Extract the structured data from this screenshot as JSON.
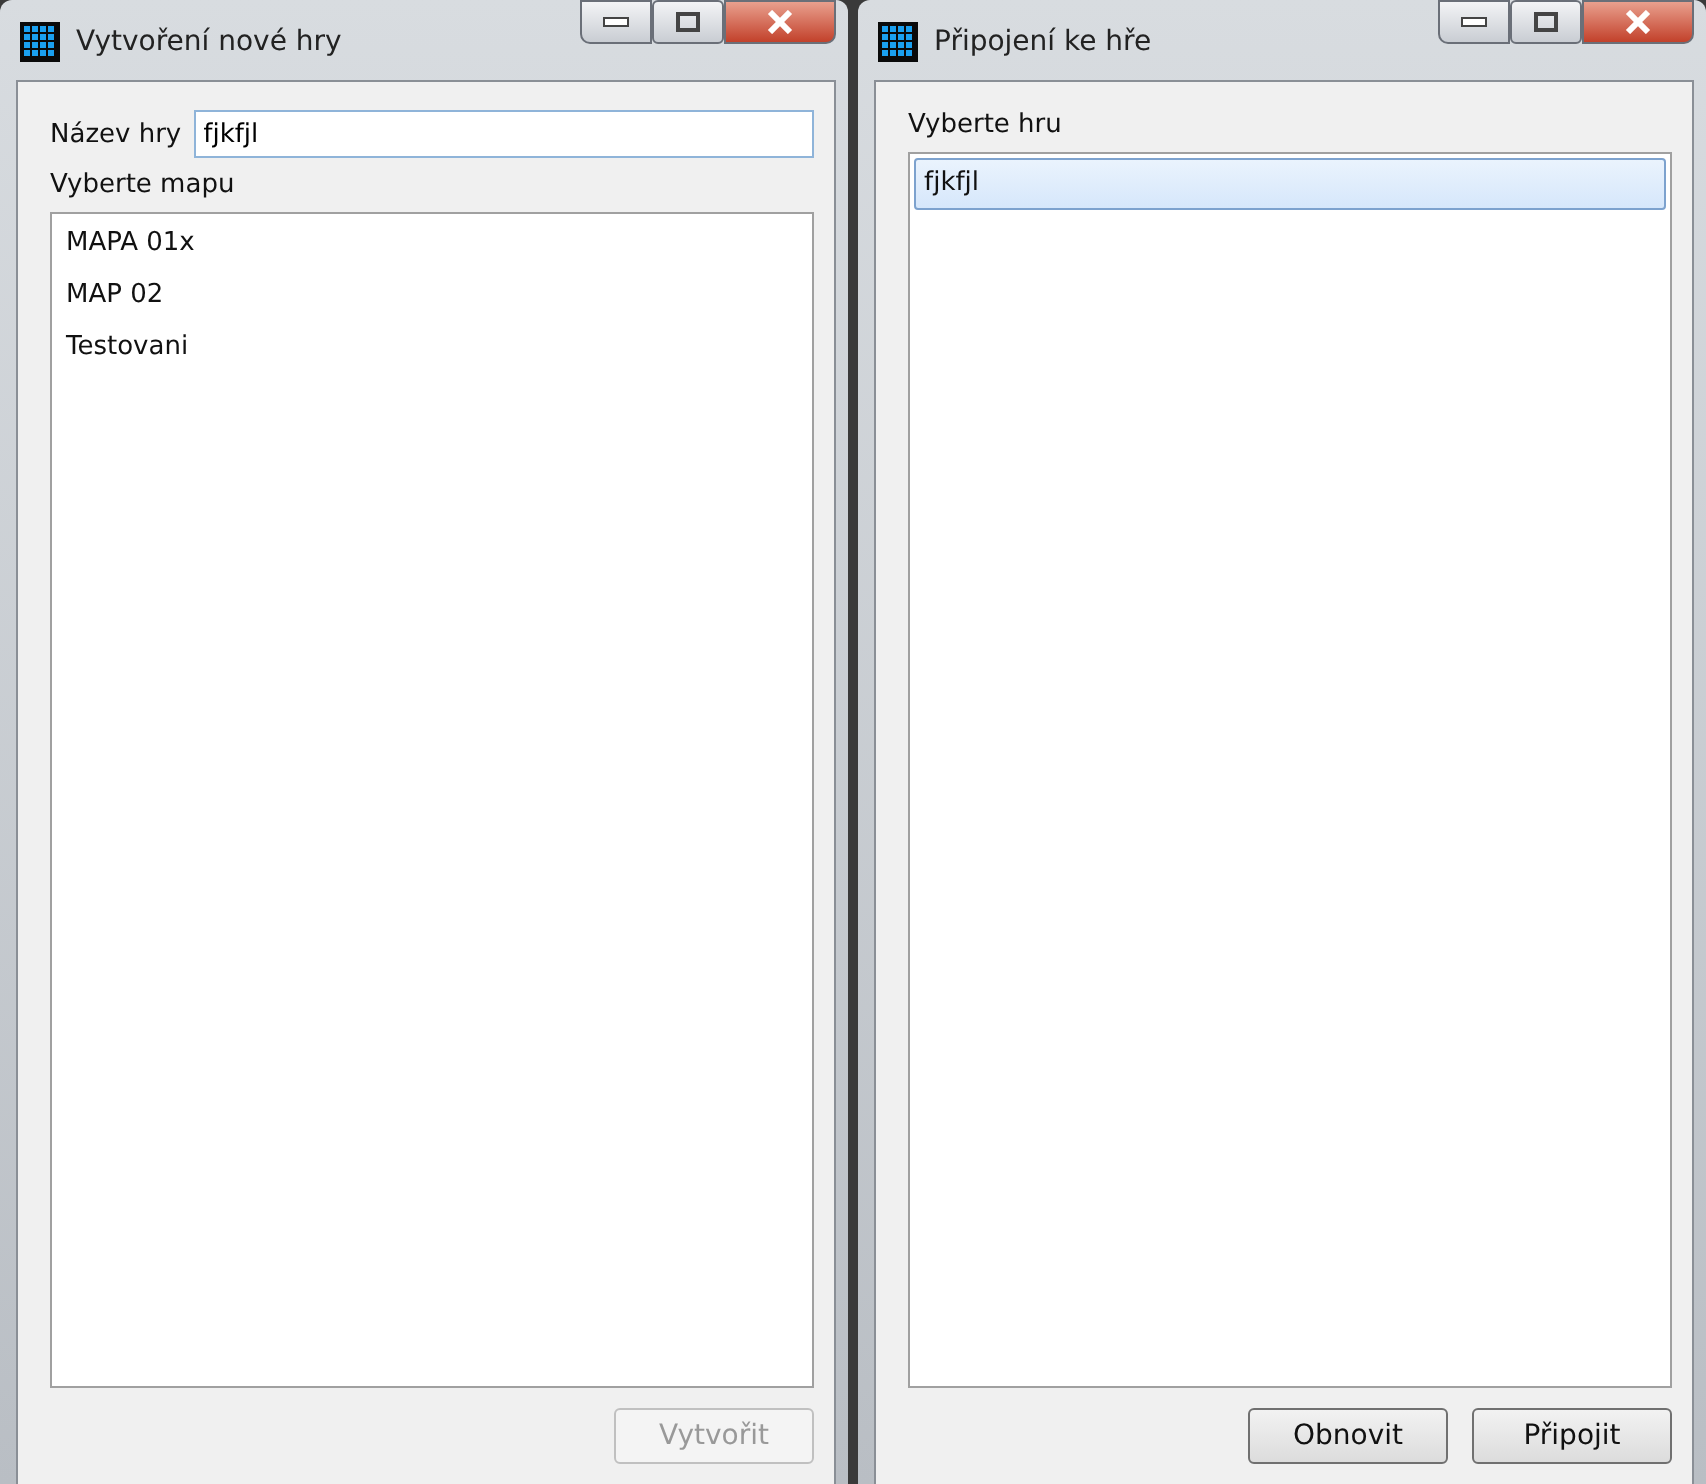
{
  "windows": [
    {
      "title": "Vytvoření nové hry",
      "name_field": {
        "label": "Název hry",
        "value": "fjkfjl"
      },
      "list_label": "Vyberte mapu",
      "items": [
        {
          "label": "MAPA 01x",
          "selected": false
        },
        {
          "label": "MAP 02",
          "selected": false
        },
        {
          "label": "Testovani",
          "selected": false
        }
      ],
      "buttons": [
        {
          "label": "Vytvořit",
          "disabled": true
        }
      ]
    },
    {
      "title": "Připojení ke hře",
      "list_label": "Vyberte hru",
      "items": [
        {
          "label": "fjkfjl",
          "selected": true
        }
      ],
      "buttons": [
        {
          "label": "Obnovit",
          "disabled": false
        },
        {
          "label": "Připojit",
          "disabled": false
        }
      ]
    }
  ]
}
